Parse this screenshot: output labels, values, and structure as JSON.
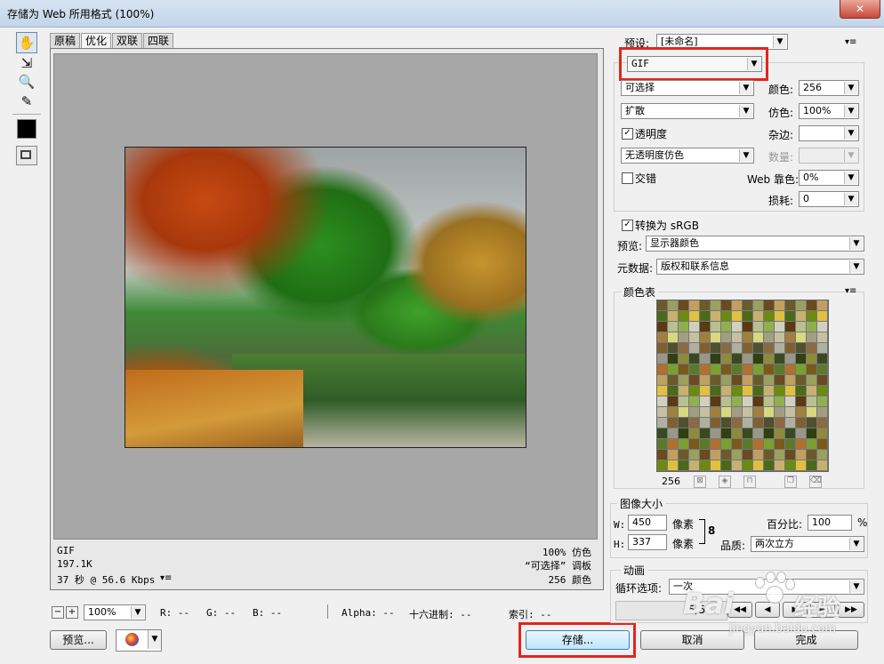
{
  "window": {
    "title": "存储为 Web 所用格式 (100%)",
    "close_glyph": "✕"
  },
  "tools": [
    "hand-icon",
    "slice-select-icon",
    "zoom-icon",
    "eyedropper-icon"
  ],
  "tabs": [
    "原稿",
    "优化",
    "双联",
    "四联"
  ],
  "image_info": {
    "format": "GIF",
    "size": "197.1K",
    "time": "37 秒 @ 56.6 Kbps",
    "time_menu": "▾≡",
    "dither": "100% 仿色",
    "palette": "“可选择” 调板",
    "colors": "256 颜色"
  },
  "status_bar": {
    "zoom_minus": "−",
    "zoom_plus": "+",
    "zoom": "100%",
    "r": "R: --",
    "g": "G: --",
    "b": "B: --",
    "alpha": "Alpha: --",
    "hex": "十六进制: --",
    "index": "索引: --"
  },
  "buttons": {
    "preview": "预览...",
    "save": "存储...",
    "cancel": "取消",
    "done": "完成"
  },
  "settings": {
    "preset_label": "预设:",
    "preset_value": "[未命名]",
    "format": "GIF",
    "reduction": "可选择",
    "dither_algo": "扩散",
    "transparency_label": "透明度",
    "transparency_dither": "无透明度仿色",
    "interlaced_label": "交错",
    "colors_label": "颜色:",
    "colors_value": "256",
    "dither_label": "仿色:",
    "dither_value": "100%",
    "matte_label": "杂边:",
    "amount_label": "数量:",
    "web_snap_label": "Web 靠色:",
    "web_snap_value": "0%",
    "lossy_label": "损耗:",
    "lossy_value": "0",
    "srgb_label": "转换为 sRGB",
    "preview_label": "预览:",
    "preview_value": "显示器颜色",
    "metadata_label": "元数据:",
    "metadata_value": "版权和联系信息"
  },
  "color_table": {
    "title": "颜色表",
    "count": "256",
    "colors": [
      "#6b5a2a",
      "#8f8a3c",
      "#c5c0a0",
      "#4a6a1a",
      "#7a5a1a",
      "#b0b0a0",
      "#5a3a10",
      "#9aa060",
      "#3a4a20",
      "#a08040",
      "#c8b070",
      "#5a7a2a",
      "#806030",
      "#b8c090",
      "#6a4a20",
      "#989888"
    ]
  },
  "image_size": {
    "title": "图像大小",
    "w_label": "W:",
    "w_value": "450",
    "h_label": "H:",
    "h_value": "337",
    "unit": "像素",
    "percent_label": "百分比:",
    "percent_value": "100",
    "percent_unit": "%",
    "quality_label": "品质:",
    "quality_value": "两次立方"
  },
  "animation": {
    "title": "动画",
    "loop_label": "循环选项:",
    "loop_value": "一次",
    "frame": "5/5"
  },
  "icons": {
    "menu": "▾≡",
    "dropdown": "▼",
    "check": "✓",
    "link": "8",
    "first_frame": "◀◀",
    "prev_frame": "◀",
    "play": "▶",
    "next_frame": "▶",
    "last_frame": "▶▶"
  },
  "watermark": {
    "brand": "Bai",
    "brand_cn": "经验",
    "url": "jingyan.baidu.com"
  }
}
